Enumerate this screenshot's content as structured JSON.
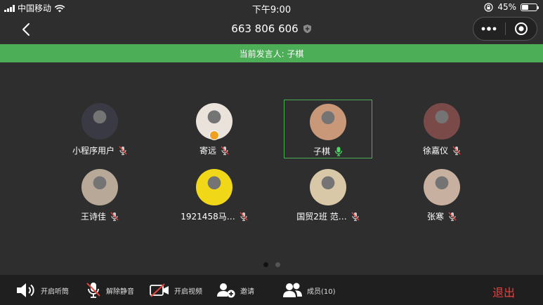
{
  "status_bar": {
    "carrier": "中国移动",
    "time": "下午9:00",
    "battery": "45%",
    "battery_level": 0.45
  },
  "nav": {
    "title": "663 806 606",
    "back_icon": "chevron-left-icon",
    "more_icon": "more-icon",
    "close_icon": "target-icon"
  },
  "banner": {
    "text": "当前发言人: 子棋",
    "color": "#4cae57"
  },
  "members": [
    {
      "name": "小程序用户",
      "mic": "muted",
      "avatar_color": "#3a3a44"
    },
    {
      "name": "寄远",
      "mic": "muted",
      "avatar_color": "#e9e3dc",
      "badge": true
    },
    {
      "name": "子棋",
      "mic": "active",
      "avatar_color": "#c89878",
      "active": true
    },
    {
      "name": "徐嘉仪",
      "mic": "muted",
      "avatar_color": "#7a4a48"
    },
    {
      "name": "王诗佳",
      "mic": "muted",
      "avatar_color": "#b8a898"
    },
    {
      "name": "1921458马…",
      "mic": "muted",
      "avatar_color": "#f0d818"
    },
    {
      "name": "国贸2班 范…",
      "mic": "muted",
      "avatar_color": "#d8c8a8"
    },
    {
      "name": "张寒",
      "mic": "muted",
      "avatar_color": "#c8b0a0"
    }
  ],
  "pagination": {
    "pages": 2,
    "current": 1
  },
  "toolbar": {
    "speaker": "开启听筒",
    "unmute": "解除静音",
    "video": "开启视频",
    "invite": "邀请",
    "members": "成员(10)",
    "exit": "退出",
    "exit_color": "#e64340"
  }
}
